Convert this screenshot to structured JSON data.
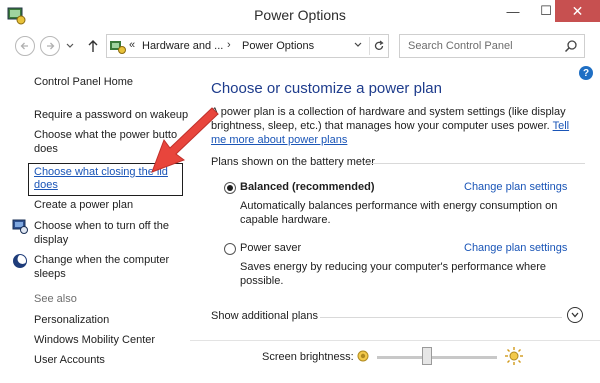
{
  "window": {
    "title": "Power Options",
    "close_glyph": "✕",
    "min_glyph": "—",
    "max_glyph": "☐"
  },
  "nav": {
    "back_icon": "back-arrow-icon",
    "forward_icon": "forward-arrow-icon",
    "up_icon": "up-arrow-icon",
    "address": {
      "chevron": "«",
      "crumbs": [
        "Hardware and ...",
        "Power Options"
      ],
      "separator": "›"
    },
    "search_placeholder": "Search Control Panel"
  },
  "left_pane": {
    "home": "Control Panel Home",
    "links": [
      "Require a password on wakeup",
      "Choose what the power butto",
      "does",
      "Choose what closing the lid",
      "does",
      "Create a power plan",
      "Choose when to turn off the",
      "display",
      "Change when the computer",
      "sleeps"
    ],
    "see_also": "See also",
    "see_also_links": [
      "Personalization",
      "Windows Mobility Center",
      "User Accounts"
    ]
  },
  "main": {
    "heading": "Choose or customize a power plan",
    "intro": "A power plan is a collection of hardware and system settings (like display brightness, sleep, etc.) that manages how your computer uses power.",
    "intro_link": "Tell me more about power plans",
    "section_label": "Plans shown on the battery meter",
    "plans": [
      {
        "name": "Balanced (recommended)",
        "selected": true,
        "description": "Automatically balances performance with energy consumption on capable hardware.",
        "change_link": "Change plan settings"
      },
      {
        "name": "Power saver",
        "selected": false,
        "description": "Saves energy by reducing your computer's performance where possible.",
        "change_link": "Change plan settings"
      }
    ],
    "show_additional": "Show additional plans",
    "brightness_label": "Screen brightness:",
    "brightness_level_fraction": 0.42
  },
  "colors": {
    "link": "#1a55b7",
    "heading": "#1e3c8c",
    "close": "#c75050",
    "annotation_arrow": "#e8453c"
  }
}
